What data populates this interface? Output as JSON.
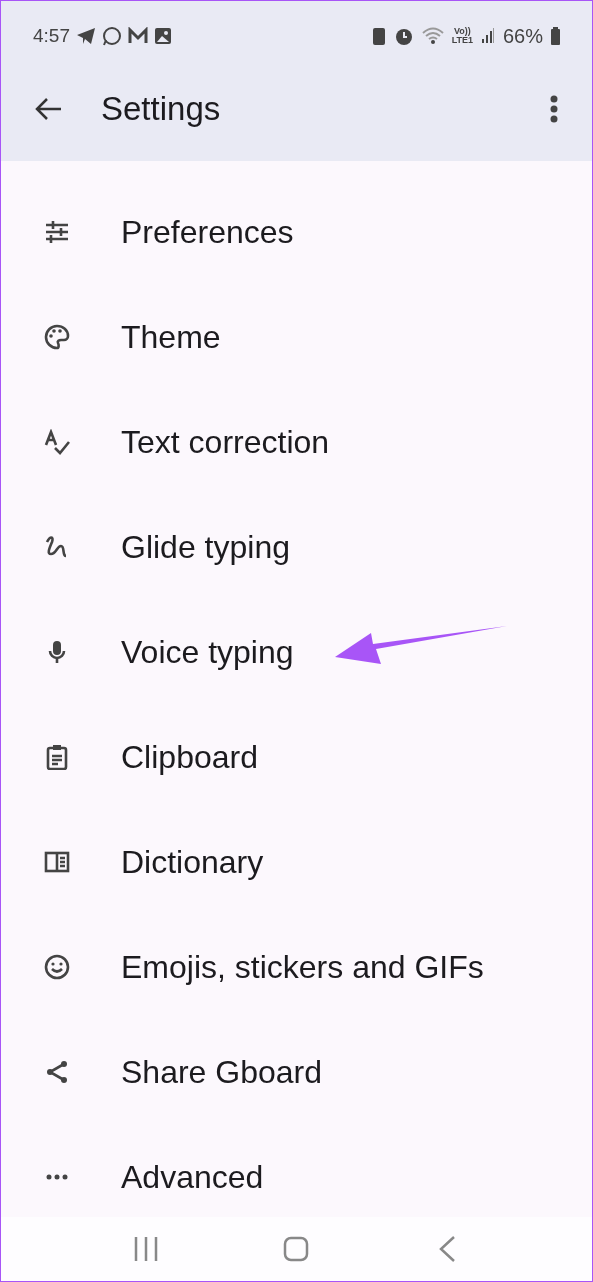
{
  "status_bar": {
    "time": "4:57",
    "network": "Vo))\nLTE1",
    "battery": "66%"
  },
  "app_bar": {
    "title": "Settings"
  },
  "items": [
    {
      "label": "Preferences"
    },
    {
      "label": "Theme"
    },
    {
      "label": "Text correction"
    },
    {
      "label": "Glide typing"
    },
    {
      "label": "Voice typing"
    },
    {
      "label": "Clipboard"
    },
    {
      "label": "Dictionary"
    },
    {
      "label": "Emojis, stickers and GIFs"
    },
    {
      "label": "Share Gboard"
    },
    {
      "label": "Advanced"
    }
  ]
}
